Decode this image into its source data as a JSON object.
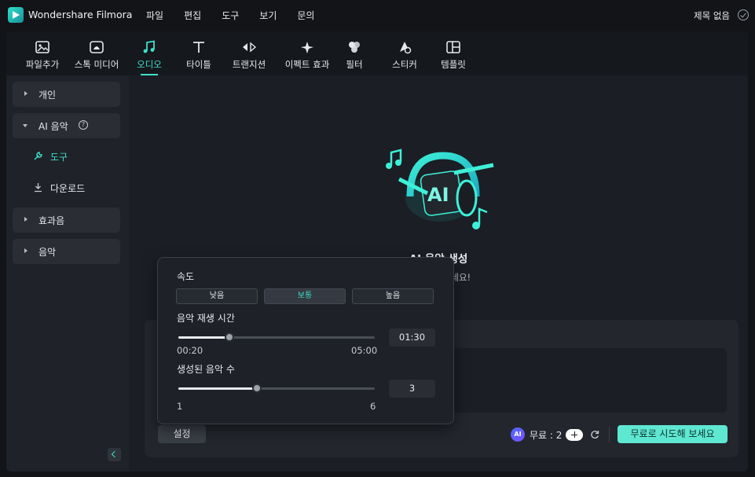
{
  "app": {
    "title": "Wondershare Filmora",
    "project_title": "제목 없음"
  },
  "menu": [
    "파일",
    "편집",
    "도구",
    "보기",
    "문의"
  ],
  "toolbar": [
    {
      "label": "파일추가",
      "icon": "import-media-icon",
      "active": false
    },
    {
      "label": "스톡 미디어",
      "icon": "stock-media-icon",
      "active": false
    },
    {
      "label": "오디오",
      "icon": "music-note-icon",
      "active": true
    },
    {
      "label": "타이틀",
      "icon": "title-text-icon",
      "active": false
    },
    {
      "label": "트랜지션",
      "icon": "transition-icon",
      "active": false
    },
    {
      "label": "이펙트 효과",
      "icon": "effects-sparkle-icon",
      "active": false
    },
    {
      "label": "필터",
      "icon": "filter-icon",
      "active": false
    },
    {
      "label": "스티커",
      "icon": "sticker-icon",
      "active": false
    },
    {
      "label": "템플릿",
      "icon": "template-icon",
      "active": false
    }
  ],
  "sidebar": {
    "personal": "개인",
    "ai_music": "AI 음악",
    "tools": "도구",
    "download": "다운로드",
    "sound_effects": "효과음",
    "music": "음악"
  },
  "main": {
    "hero_title": "AI 음악 생성",
    "hero_subtitle": "을 만들어보세요!",
    "settings_button": "설정",
    "credit_text": "무료 : 2",
    "try_button": "무료로 시도해 보세요"
  },
  "popover": {
    "speed_label": "속도",
    "speed_options": [
      "낮음",
      "보통",
      "높음"
    ],
    "speed_selected": "보통",
    "duration_label": "음악 재생 시간",
    "duration_value": "01:30",
    "duration_min": "00:20",
    "duration_max": "05:00",
    "duration_fraction": 0.26,
    "count_label": "생성된 음악 수",
    "count_value": "3",
    "count_min": "1",
    "count_max": "6",
    "count_fraction": 0.4
  },
  "colors": {
    "accent": "#3ee0cb",
    "try_button_bg": "#5ee8d2",
    "panel_bg": "#1b1e24"
  }
}
